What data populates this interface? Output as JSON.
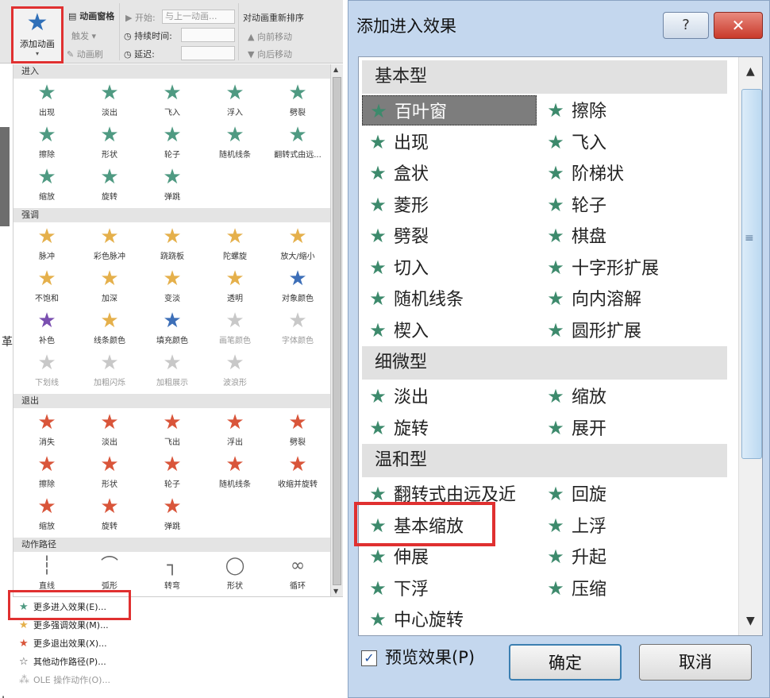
{
  "ribbon": {
    "add_animation": "添加动画",
    "animation_pane": "动画窗格",
    "trigger": "触发 ▾",
    "animation_painter": "动画刷",
    "start_label": "开始:",
    "start_value": "与上一动画...",
    "duration_label": "持续时间:",
    "delay_label": "延迟:",
    "reorder_title": "对动画重新排序",
    "move_earlier": "向前移动",
    "move_later": "向后移动"
  },
  "gallery": {
    "sections": [
      {
        "title": "进入",
        "items": [
          {
            "label": "出现",
            "icon": "star-icon",
            "color": "green"
          },
          {
            "label": "淡出",
            "icon": "star-icon",
            "color": "green"
          },
          {
            "label": "飞入",
            "icon": "star-icon",
            "color": "green"
          },
          {
            "label": "浮入",
            "icon": "star-icon",
            "color": "green"
          },
          {
            "label": "劈裂",
            "icon": "star-icon",
            "color": "green"
          },
          {
            "label": "擦除",
            "icon": "star-icon",
            "color": "green"
          },
          {
            "label": "形状",
            "icon": "star-icon",
            "color": "green"
          },
          {
            "label": "轮子",
            "icon": "star-icon",
            "color": "green"
          },
          {
            "label": "随机线条",
            "icon": "star-icon",
            "color": "green"
          },
          {
            "label": "翻转式由远...",
            "icon": "star-icon",
            "color": "green"
          },
          {
            "label": "缩放",
            "icon": "star-icon",
            "color": "green"
          },
          {
            "label": "旋转",
            "icon": "star-icon",
            "color": "green"
          },
          {
            "label": "弹跳",
            "icon": "star-icon",
            "color": "green"
          }
        ]
      },
      {
        "title": "强调",
        "items": [
          {
            "label": "脉冲",
            "icon": "star-icon",
            "color": "gold"
          },
          {
            "label": "彩色脉冲",
            "icon": "star-icon",
            "color": "gold"
          },
          {
            "label": "跷跷板",
            "icon": "star-icon",
            "color": "gold"
          },
          {
            "label": "陀螺旋",
            "icon": "star-icon",
            "color": "gold"
          },
          {
            "label": "放大/缩小",
            "icon": "star-icon",
            "color": "gold"
          },
          {
            "label": "不饱和",
            "icon": "star-icon",
            "color": "gold"
          },
          {
            "label": "加深",
            "icon": "star-icon",
            "color": "gold"
          },
          {
            "label": "变淡",
            "icon": "star-icon",
            "color": "gold"
          },
          {
            "label": "透明",
            "icon": "star-icon",
            "color": "gold"
          },
          {
            "label": "对象颜色",
            "icon": "star-icon",
            "color": "blue"
          },
          {
            "label": "补色",
            "icon": "star-icon",
            "color": "purple"
          },
          {
            "label": "线条颜色",
            "icon": "star-icon",
            "color": "gold"
          },
          {
            "label": "填充颜色",
            "icon": "star-icon",
            "color": "blue"
          },
          {
            "label": "画笔颜色",
            "icon": "star-icon",
            "color": "grey",
            "dim": true
          },
          {
            "label": "字体颜色",
            "icon": "star-icon",
            "color": "grey",
            "dim": true
          },
          {
            "label": "下划线",
            "icon": "star-icon",
            "color": "grey",
            "dim": true
          },
          {
            "label": "加粗闪烁",
            "icon": "star-icon",
            "color": "grey",
            "dim": true
          },
          {
            "label": "加粗展示",
            "icon": "star-icon",
            "color": "grey",
            "dim": true
          },
          {
            "label": "波浪形",
            "icon": "star-icon",
            "color": "grey",
            "dim": true
          }
        ]
      },
      {
        "title": "退出",
        "items": [
          {
            "label": "消失",
            "icon": "star-icon",
            "color": "red"
          },
          {
            "label": "淡出",
            "icon": "star-icon",
            "color": "red"
          },
          {
            "label": "飞出",
            "icon": "star-icon",
            "color": "red"
          },
          {
            "label": "浮出",
            "icon": "star-icon",
            "color": "red"
          },
          {
            "label": "劈裂",
            "icon": "star-icon",
            "color": "red"
          },
          {
            "label": "擦除",
            "icon": "star-icon",
            "color": "red"
          },
          {
            "label": "形状",
            "icon": "star-icon",
            "color": "red"
          },
          {
            "label": "轮子",
            "icon": "star-icon",
            "color": "red"
          },
          {
            "label": "随机线条",
            "icon": "star-icon",
            "color": "red"
          },
          {
            "label": "收缩并旋转",
            "icon": "star-icon",
            "color": "red"
          },
          {
            "label": "缩放",
            "icon": "star-icon",
            "color": "red"
          },
          {
            "label": "旋转",
            "icon": "star-icon",
            "color": "red"
          },
          {
            "label": "弹跳",
            "icon": "star-icon",
            "color": "red"
          }
        ]
      },
      {
        "title": "动作路径",
        "items": [
          {
            "label": "直线",
            "icon": "line-path-icon",
            "color": "path"
          },
          {
            "label": "弧形",
            "icon": "arc-path-icon",
            "color": "path"
          },
          {
            "label": "转弯",
            "icon": "turn-path-icon",
            "color": "path"
          },
          {
            "label": "形状",
            "icon": "circle-path-icon",
            "color": "path"
          },
          {
            "label": "循环",
            "icon": "loop-path-icon",
            "color": "path"
          }
        ]
      }
    ],
    "more": [
      {
        "label": "更多进入效果(E)...",
        "icon": "green-star-icon",
        "color": "#4f9a82"
      },
      {
        "label": "更多强调效果(M)...",
        "icon": "gold-star-icon",
        "color": "#e5b04b"
      },
      {
        "label": "更多退出效果(X)...",
        "icon": "red-star-icon",
        "color": "#d9553a"
      },
      {
        "label": "其他动作路径(P)...",
        "icon": "outline-star-icon",
        "color": "#444444"
      },
      {
        "label": "OLE 操作动作(O)...",
        "icon": "ole-icon",
        "color": "#aaaaaa",
        "dim": true
      }
    ]
  },
  "dialog": {
    "title": "添加进入效果",
    "help": "?",
    "close": "✕",
    "groups": [
      {
        "title": "基本型",
        "rows": [
          [
            "百叶窗",
            "擦除"
          ],
          [
            "出现",
            "飞入"
          ],
          [
            "盒状",
            "阶梯状"
          ],
          [
            "菱形",
            "轮子"
          ],
          [
            "劈裂",
            "棋盘"
          ],
          [
            "切入",
            "十字形扩展"
          ],
          [
            "随机线条",
            "向内溶解"
          ],
          [
            "楔入",
            "圆形扩展"
          ]
        ]
      },
      {
        "title": "细微型",
        "rows": [
          [
            "淡出",
            "缩放"
          ],
          [
            "旋转",
            "展开"
          ]
        ]
      },
      {
        "title": "温和型",
        "rows": [
          [
            "翻转式由远及近",
            "回旋"
          ],
          [
            "基本缩放",
            "上浮"
          ],
          [
            "伸展",
            "升起"
          ],
          [
            "下浮",
            "压缩"
          ],
          [
            "中心旋转",
            ""
          ]
        ]
      }
    ],
    "selected": "百叶窗",
    "preview_label": "预览效果(P)",
    "preview_checked": true,
    "ok": "确定",
    "cancel": "取消",
    "colors": {
      "star": "#3d8a6c",
      "highlight": "#e03030"
    }
  }
}
